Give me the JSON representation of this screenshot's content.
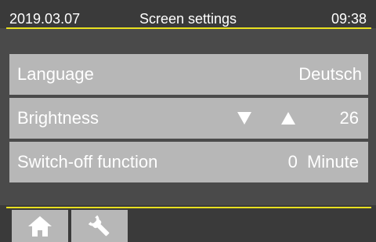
{
  "status": {
    "date": "2019.03.07",
    "title": "Screen settings",
    "time": "09:38"
  },
  "settings": [
    {
      "label": "Language",
      "value": "Deutsch"
    },
    {
      "label": "Brightness",
      "value": "26",
      "decrease_icon": "triangle-down-icon",
      "increase_icon": "triangle-up-icon"
    },
    {
      "label": "Switch-off function",
      "value": "0 Minute"
    }
  ],
  "tabs": [
    {
      "icon": "home-icon"
    },
    {
      "icon": "wrench-icon"
    }
  ],
  "colors": {
    "background": "#4a4a4a",
    "row": "#b7b7b7",
    "accent_line": "#e8e020",
    "text": "#ffffff"
  }
}
